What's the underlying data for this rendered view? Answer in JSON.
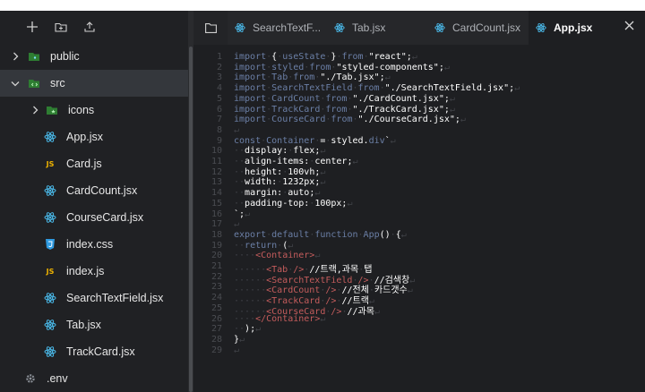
{
  "sidebar": {
    "toolbar": [
      "new-file",
      "new-folder",
      "upload"
    ],
    "items": [
      {
        "label": "public",
        "kind": "folder",
        "expanded": false
      },
      {
        "label": "src",
        "kind": "folder",
        "expanded": true
      },
      {
        "label": "icons",
        "kind": "folder",
        "expanded": false
      },
      {
        "label": "App.jsx",
        "kind": "react"
      },
      {
        "label": "Card.js",
        "kind": "js"
      },
      {
        "label": "CardCount.jsx",
        "kind": "react"
      },
      {
        "label": "CourseCard.jsx",
        "kind": "react"
      },
      {
        "label": "index.css",
        "kind": "css"
      },
      {
        "label": "index.js",
        "kind": "js"
      },
      {
        "label": "SearchTextField.jsx",
        "kind": "react"
      },
      {
        "label": "Tab.jsx",
        "kind": "react"
      },
      {
        "label": "TrackCard.jsx",
        "kind": "react"
      },
      {
        "label": ".env",
        "kind": "settings"
      }
    ]
  },
  "editor": {
    "tabs": [
      {
        "label": "SearchTextF..."
      },
      {
        "label": "Tab.jsx"
      },
      {
        "label": "CardCount.jsx"
      },
      {
        "label": "App.jsx",
        "active": true
      }
    ],
    "line_numbers": [
      "1",
      "2",
      "3",
      "4",
      "5",
      "6",
      "7",
      "8",
      "9",
      "10",
      "11",
      "12",
      "13",
      "14",
      "15",
      "16",
      "17",
      "18",
      "19",
      "20",
      "21",
      "22",
      "23",
      "24",
      "25",
      "26",
      "27",
      "28",
      "29"
    ],
    "lines": [
      [
        [
          "kw",
          "import"
        ],
        [
          "ws",
          "·"
        ],
        [
          "str",
          "{"
        ],
        [
          "ws",
          "·"
        ],
        [
          "id",
          "useState"
        ],
        [
          "ws",
          "·"
        ],
        [
          "str",
          "}"
        ],
        [
          "ws",
          "·"
        ],
        [
          "kw",
          "from"
        ],
        [
          "ws",
          "·"
        ],
        [
          "str",
          "\"react\";"
        ],
        [
          "ws",
          "↵"
        ]
      ],
      [
        [
          "kw",
          "import"
        ],
        [
          "ws",
          "·"
        ],
        [
          "id",
          "styled"
        ],
        [
          "ws",
          "·"
        ],
        [
          "kw",
          "from"
        ],
        [
          "ws",
          "·"
        ],
        [
          "str",
          "\"styled-components\";"
        ],
        [
          "ws",
          "↵"
        ]
      ],
      [
        [
          "kw",
          "import"
        ],
        [
          "ws",
          "·"
        ],
        [
          "id",
          "Tab"
        ],
        [
          "ws",
          "·"
        ],
        [
          "kw",
          "from"
        ],
        [
          "ws",
          "·"
        ],
        [
          "str",
          "\"./Tab.jsx\";"
        ],
        [
          "ws",
          "↵"
        ]
      ],
      [
        [
          "kw",
          "import"
        ],
        [
          "ws",
          "·"
        ],
        [
          "id",
          "SearchTextField"
        ],
        [
          "ws",
          "·"
        ],
        [
          "kw",
          "from"
        ],
        [
          "ws",
          "·"
        ],
        [
          "str",
          "\"./SearchTextField.jsx\";"
        ],
        [
          "ws",
          "↵"
        ]
      ],
      [
        [
          "kw",
          "import"
        ],
        [
          "ws",
          "·"
        ],
        [
          "id",
          "CardCount"
        ],
        [
          "ws",
          "·"
        ],
        [
          "kw",
          "from"
        ],
        [
          "ws",
          "·"
        ],
        [
          "str",
          "\"./CardCount.jsx\";"
        ],
        [
          "ws",
          "↵"
        ]
      ],
      [
        [
          "kw",
          "import"
        ],
        [
          "ws",
          "·"
        ],
        [
          "id",
          "TrackCard"
        ],
        [
          "ws",
          "·"
        ],
        [
          "kw",
          "from"
        ],
        [
          "ws",
          "·"
        ],
        [
          "str",
          "\"./TrackCard.jsx\";"
        ],
        [
          "ws",
          "↵"
        ]
      ],
      [
        [
          "kw",
          "import"
        ],
        [
          "ws",
          "·"
        ],
        [
          "id",
          "CourseCard"
        ],
        [
          "ws",
          "·"
        ],
        [
          "kw",
          "from"
        ],
        [
          "ws",
          "·"
        ],
        [
          "str",
          "\"./CourseCard.jsx\";"
        ],
        [
          "ws",
          "↵"
        ]
      ],
      [
        [
          "ws",
          "↵"
        ]
      ],
      [
        [
          "kw",
          "const"
        ],
        [
          "ws",
          "·"
        ],
        [
          "id",
          "Container"
        ],
        [
          "ws",
          "·"
        ],
        [
          "str",
          "="
        ],
        [
          "ws",
          "·"
        ],
        [
          "str",
          "styled."
        ],
        [
          "id",
          "div"
        ],
        [
          "str",
          "`"
        ],
        [
          "ws",
          "↵"
        ]
      ],
      [
        [
          "ws",
          "··"
        ],
        [
          "str",
          "display:"
        ],
        [
          "ws",
          "·"
        ],
        [
          "str",
          "flex;"
        ],
        [
          "ws",
          "↵"
        ]
      ],
      [
        [
          "ws",
          "··"
        ],
        [
          "str",
          "align-items:"
        ],
        [
          "ws",
          "·"
        ],
        [
          "str",
          "center;"
        ],
        [
          "ws",
          "↵"
        ]
      ],
      [
        [
          "ws",
          "··"
        ],
        [
          "str",
          "height:"
        ],
        [
          "ws",
          "·"
        ],
        [
          "str",
          "100vh;"
        ],
        [
          "ws",
          "↵"
        ]
      ],
      [
        [
          "ws",
          "··"
        ],
        [
          "str",
          "width:"
        ],
        [
          "ws",
          "·"
        ],
        [
          "str",
          "1232px;"
        ],
        [
          "ws",
          "↵"
        ]
      ],
      [
        [
          "ws",
          "··"
        ],
        [
          "str",
          "margin:"
        ],
        [
          "ws",
          "·"
        ],
        [
          "str",
          "auto;"
        ],
        [
          "ws",
          "↵"
        ]
      ],
      [
        [
          "ws",
          "··"
        ],
        [
          "str",
          "padding-top:"
        ],
        [
          "ws",
          "·"
        ],
        [
          "str",
          "100px;"
        ],
        [
          "ws",
          "↵"
        ]
      ],
      [
        [
          "str",
          "`;"
        ],
        [
          "ws",
          "↵"
        ]
      ],
      [
        [
          "ws",
          "↵"
        ]
      ],
      [
        [
          "kw",
          "export"
        ],
        [
          "ws",
          "·"
        ],
        [
          "kw",
          "default"
        ],
        [
          "ws",
          "·"
        ],
        [
          "kw",
          "function"
        ],
        [
          "ws",
          "·"
        ],
        [
          "id",
          "App"
        ],
        [
          "str",
          "()"
        ],
        [
          "ws",
          "·"
        ],
        [
          "str",
          "{"
        ],
        [
          "ws",
          "↵"
        ]
      ],
      [
        [
          "ws",
          "··"
        ],
        [
          "kw",
          "return"
        ],
        [
          "ws",
          "·"
        ],
        [
          "str",
          "("
        ],
        [
          "ws",
          "↵"
        ]
      ],
      [
        [
          "ws",
          "····"
        ],
        [
          "tag",
          "<Container>"
        ],
        [
          "ws",
          "↵"
        ]
      ],
      [
        [
          "ws",
          "······"
        ],
        [
          "tag",
          "<Tab"
        ],
        [
          "ws",
          "·"
        ],
        [
          "tag",
          "/>"
        ],
        [
          "ws",
          "·"
        ],
        [
          "str",
          "//트랙,과목"
        ],
        [
          "ws",
          "·"
        ],
        [
          "str",
          "탭"
        ]
      ],
      [
        [
          "ws",
          "······"
        ],
        [
          "tag",
          "<SearchTextField"
        ],
        [
          "ws",
          "·"
        ],
        [
          "tag",
          "/>"
        ],
        [
          "ws",
          "·"
        ],
        [
          "str",
          "//검색창"
        ],
        [
          "ws",
          "↵"
        ]
      ],
      [
        [
          "ws",
          "······"
        ],
        [
          "tag",
          "<CardCount"
        ],
        [
          "ws",
          "·"
        ],
        [
          "tag",
          "/>"
        ],
        [
          "ws",
          "·"
        ],
        [
          "str",
          "//전체"
        ],
        [
          "ws",
          "·"
        ],
        [
          "str",
          "카드갯수"
        ],
        [
          "ws",
          "↵"
        ]
      ],
      [
        [
          "ws",
          "······"
        ],
        [
          "tag",
          "<TrackCard"
        ],
        [
          "ws",
          "·"
        ],
        [
          "tag",
          "/>"
        ],
        [
          "ws",
          "·"
        ],
        [
          "str",
          "//트랙"
        ],
        [
          "ws",
          "↵"
        ]
      ],
      [
        [
          "ws",
          "······"
        ],
        [
          "tag",
          "<CourseCard"
        ],
        [
          "ws",
          "·"
        ],
        [
          "tag",
          "/>"
        ],
        [
          "ws",
          "·"
        ],
        [
          "str",
          "//과목"
        ],
        [
          "ws",
          "↵"
        ]
      ],
      [
        [
          "ws",
          "····"
        ],
        [
          "tag",
          "</Container>"
        ],
        [
          "ws",
          "↵"
        ]
      ],
      [
        [
          "ws",
          "··"
        ],
        [
          "str",
          ");"
        ],
        [
          "ws",
          "↵"
        ]
      ],
      [
        [
          "str",
          "}"
        ],
        [
          "ws",
          "↵"
        ]
      ],
      [
        [
          "ws",
          "↵"
        ]
      ]
    ]
  }
}
